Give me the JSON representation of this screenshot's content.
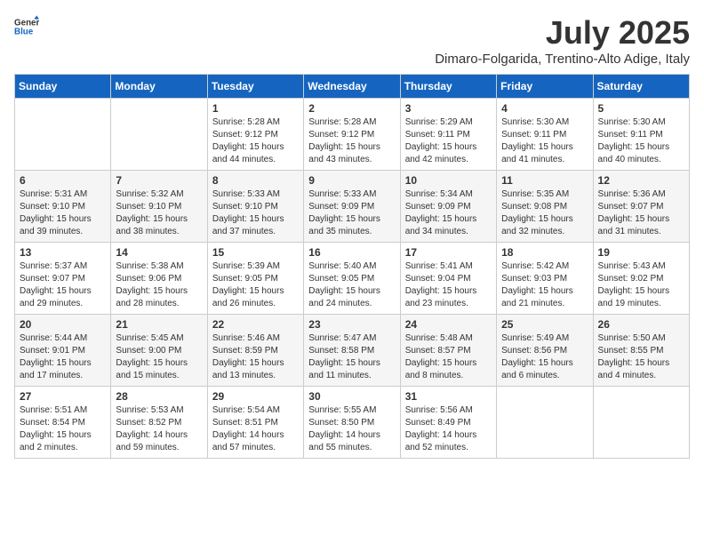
{
  "header": {
    "logo_line1": "General",
    "logo_line2": "Blue",
    "month_year": "July 2025",
    "location": "Dimaro-Folgarida, Trentino-Alto Adige, Italy"
  },
  "days_of_week": [
    "Sunday",
    "Monday",
    "Tuesday",
    "Wednesday",
    "Thursday",
    "Friday",
    "Saturday"
  ],
  "weeks": [
    [
      {
        "day": "",
        "info": ""
      },
      {
        "day": "",
        "info": ""
      },
      {
        "day": "1",
        "info": "Sunrise: 5:28 AM\nSunset: 9:12 PM\nDaylight: 15 hours and 44 minutes."
      },
      {
        "day": "2",
        "info": "Sunrise: 5:28 AM\nSunset: 9:12 PM\nDaylight: 15 hours and 43 minutes."
      },
      {
        "day": "3",
        "info": "Sunrise: 5:29 AM\nSunset: 9:11 PM\nDaylight: 15 hours and 42 minutes."
      },
      {
        "day": "4",
        "info": "Sunrise: 5:30 AM\nSunset: 9:11 PM\nDaylight: 15 hours and 41 minutes."
      },
      {
        "day": "5",
        "info": "Sunrise: 5:30 AM\nSunset: 9:11 PM\nDaylight: 15 hours and 40 minutes."
      }
    ],
    [
      {
        "day": "6",
        "info": "Sunrise: 5:31 AM\nSunset: 9:10 PM\nDaylight: 15 hours and 39 minutes."
      },
      {
        "day": "7",
        "info": "Sunrise: 5:32 AM\nSunset: 9:10 PM\nDaylight: 15 hours and 38 minutes."
      },
      {
        "day": "8",
        "info": "Sunrise: 5:33 AM\nSunset: 9:10 PM\nDaylight: 15 hours and 37 minutes."
      },
      {
        "day": "9",
        "info": "Sunrise: 5:33 AM\nSunset: 9:09 PM\nDaylight: 15 hours and 35 minutes."
      },
      {
        "day": "10",
        "info": "Sunrise: 5:34 AM\nSunset: 9:09 PM\nDaylight: 15 hours and 34 minutes."
      },
      {
        "day": "11",
        "info": "Sunrise: 5:35 AM\nSunset: 9:08 PM\nDaylight: 15 hours and 32 minutes."
      },
      {
        "day": "12",
        "info": "Sunrise: 5:36 AM\nSunset: 9:07 PM\nDaylight: 15 hours and 31 minutes."
      }
    ],
    [
      {
        "day": "13",
        "info": "Sunrise: 5:37 AM\nSunset: 9:07 PM\nDaylight: 15 hours and 29 minutes."
      },
      {
        "day": "14",
        "info": "Sunrise: 5:38 AM\nSunset: 9:06 PM\nDaylight: 15 hours and 28 minutes."
      },
      {
        "day": "15",
        "info": "Sunrise: 5:39 AM\nSunset: 9:05 PM\nDaylight: 15 hours and 26 minutes."
      },
      {
        "day": "16",
        "info": "Sunrise: 5:40 AM\nSunset: 9:05 PM\nDaylight: 15 hours and 24 minutes."
      },
      {
        "day": "17",
        "info": "Sunrise: 5:41 AM\nSunset: 9:04 PM\nDaylight: 15 hours and 23 minutes."
      },
      {
        "day": "18",
        "info": "Sunrise: 5:42 AM\nSunset: 9:03 PM\nDaylight: 15 hours and 21 minutes."
      },
      {
        "day": "19",
        "info": "Sunrise: 5:43 AM\nSunset: 9:02 PM\nDaylight: 15 hours and 19 minutes."
      }
    ],
    [
      {
        "day": "20",
        "info": "Sunrise: 5:44 AM\nSunset: 9:01 PM\nDaylight: 15 hours and 17 minutes."
      },
      {
        "day": "21",
        "info": "Sunrise: 5:45 AM\nSunset: 9:00 PM\nDaylight: 15 hours and 15 minutes."
      },
      {
        "day": "22",
        "info": "Sunrise: 5:46 AM\nSunset: 8:59 PM\nDaylight: 15 hours and 13 minutes."
      },
      {
        "day": "23",
        "info": "Sunrise: 5:47 AM\nSunset: 8:58 PM\nDaylight: 15 hours and 11 minutes."
      },
      {
        "day": "24",
        "info": "Sunrise: 5:48 AM\nSunset: 8:57 PM\nDaylight: 15 hours and 8 minutes."
      },
      {
        "day": "25",
        "info": "Sunrise: 5:49 AM\nSunset: 8:56 PM\nDaylight: 15 hours and 6 minutes."
      },
      {
        "day": "26",
        "info": "Sunrise: 5:50 AM\nSunset: 8:55 PM\nDaylight: 15 hours and 4 minutes."
      }
    ],
    [
      {
        "day": "27",
        "info": "Sunrise: 5:51 AM\nSunset: 8:54 PM\nDaylight: 15 hours and 2 minutes."
      },
      {
        "day": "28",
        "info": "Sunrise: 5:53 AM\nSunset: 8:52 PM\nDaylight: 14 hours and 59 minutes."
      },
      {
        "day": "29",
        "info": "Sunrise: 5:54 AM\nSunset: 8:51 PM\nDaylight: 14 hours and 57 minutes."
      },
      {
        "day": "30",
        "info": "Sunrise: 5:55 AM\nSunset: 8:50 PM\nDaylight: 14 hours and 55 minutes."
      },
      {
        "day": "31",
        "info": "Sunrise: 5:56 AM\nSunset: 8:49 PM\nDaylight: 14 hours and 52 minutes."
      },
      {
        "day": "",
        "info": ""
      },
      {
        "day": "",
        "info": ""
      }
    ]
  ]
}
